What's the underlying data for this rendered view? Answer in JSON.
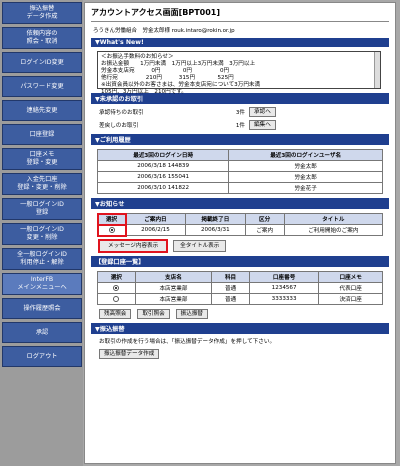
{
  "sidebar": {
    "items": [
      {
        "label": "振込振替\nデータ作成"
      },
      {
        "label": "依頼内容の\n照会・取消"
      },
      {
        "label": "ログインID変更"
      },
      {
        "label": "パスワード変更"
      },
      {
        "label": "連絡先変更"
      },
      {
        "label": "口座登録"
      },
      {
        "label": "口座メモ\n登録・変更"
      },
      {
        "label": "入金先口座\n登録・変更・削除"
      },
      {
        "label": "一般ログインID\n登録"
      },
      {
        "label": "一般ログインID\n変更・削除"
      },
      {
        "label": "全一般ログインID\n利用停止・解除"
      },
      {
        "label": "InterFB\nメインメニューへ"
      },
      {
        "label": "操作履歴照会"
      },
      {
        "label": "承認"
      },
      {
        "label": "ログアウト"
      }
    ]
  },
  "page": {
    "title": "アカウントアクセス画面[BPT001]",
    "user_line": "ろうきん労働組合　労金太郎様 rouk.intaro@rokin.or.jp"
  },
  "whats_new": {
    "title": "▼What's New!",
    "lines": [
      "＜お振込手数料のお知らせ＞",
      "お振込金額　　1万円未満　1万円以上3万円未満　3万円以上",
      "労金本支店宛　　　0円　　　　0円　　　　　0円",
      "他行宛　　　　　210円　　　315円　　　　525円",
      "※出資会員以外のお客さまは、労金本支店宛について3万円未満",
      "105円、3万円以上　210円です。"
    ]
  },
  "pending": {
    "title": "▼未承認のお取引",
    "rows": [
      {
        "label": "承認待ちのお取引",
        "count": "3件",
        "button": "承認へ"
      },
      {
        "label": "差戻しのお取引",
        "count": "1件",
        "button": "編集へ"
      }
    ]
  },
  "history": {
    "title": "▼ご利用履歴",
    "headers": [
      "最近3回のログイン日時",
      "最近3回のログインユーザ名"
    ],
    "rows": [
      [
        "2006/3/18 144839",
        "労金太郎"
      ],
      [
        "2006/3/16 155041",
        "労金太郎"
      ],
      [
        "2006/3/10 141822",
        "労金花子"
      ]
    ]
  },
  "notice": {
    "title": "▼お知らせ",
    "headers": [
      "選択",
      "ご案内日",
      "掲載終了日",
      "区分",
      "タイトル"
    ],
    "row": [
      "2006/2/15",
      "2006/3/31",
      "ご案内",
      "ご利用開始のご案内"
    ],
    "btn_show": "メッセージ内容表示",
    "btn_all": "全タイトル表示"
  },
  "accounts": {
    "title": "【登録口座一覧】",
    "headers": [
      "選択",
      "支店名",
      "科目",
      "口座番号",
      "口座メモ"
    ],
    "rows": [
      [
        "本店営業部",
        "普通",
        "1234567",
        "代表口座"
      ],
      [
        "本店営業部",
        "普通",
        "3333333",
        "決済口座"
      ]
    ],
    "buttons": [
      "残高照会",
      "取引照会",
      "振込振替"
    ]
  },
  "transfer": {
    "title": "▼振込振替",
    "note": "お取引の作成を行う場合は、「振込振替データ作成」を押して下さい。",
    "button": "振込振替データ作成"
  }
}
